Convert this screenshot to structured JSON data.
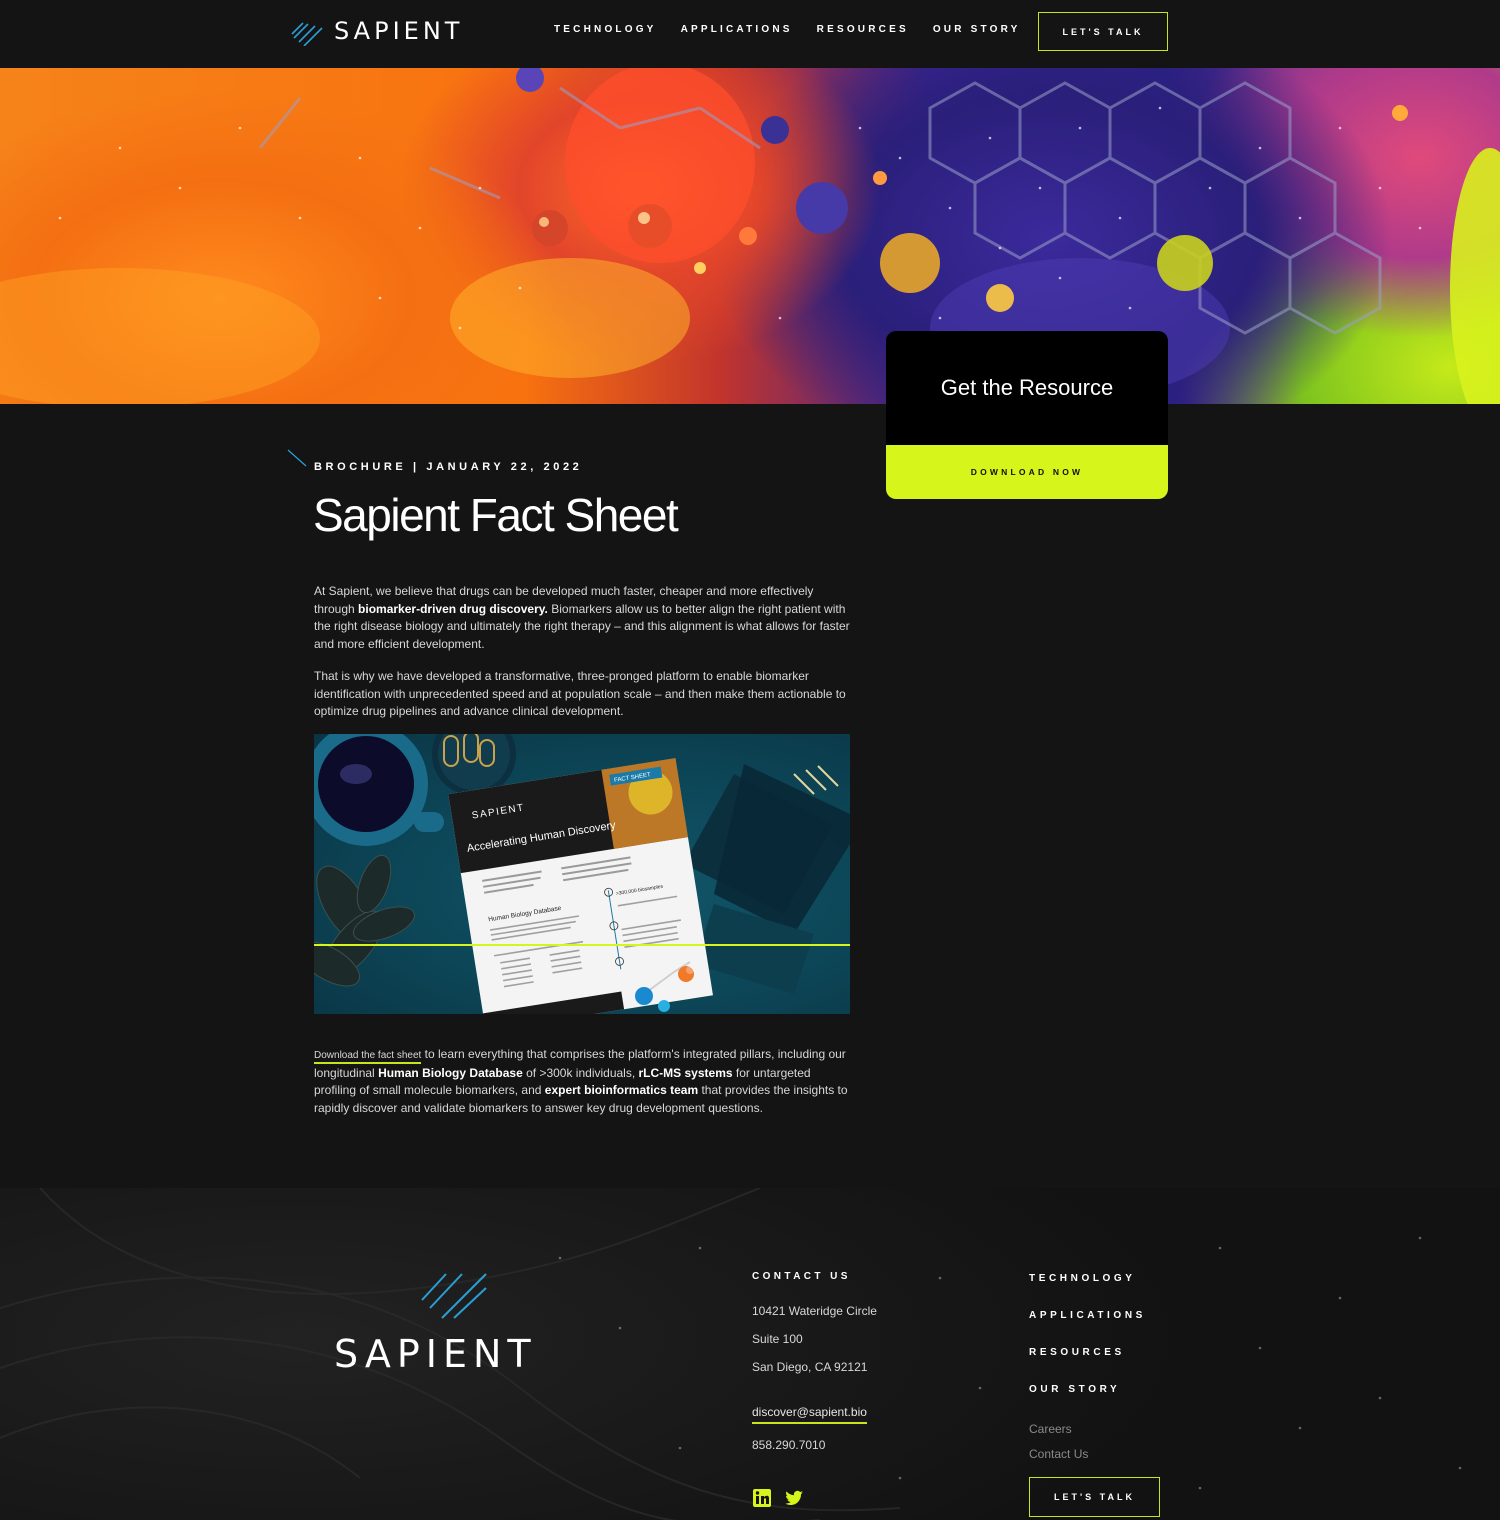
{
  "header": {
    "logo_text": "SAPIENT",
    "nav": [
      "TECHNOLOGY",
      "APPLICATIONS",
      "RESOURCES",
      "OUR STORY"
    ],
    "cta": "LET'S TALK"
  },
  "resource_card": {
    "title": "Get the Resource",
    "button": "DOWNLOAD NOW"
  },
  "article": {
    "meta": "BROCHURE | JANUARY 22, 2022",
    "title": "Sapient Fact Sheet",
    "p1_a": "At Sapient, we believe that drugs can be developed much faster, cheaper and more effectively through ",
    "p1_b": "biomarker-driven drug discovery.",
    "p1_c": " Biomarkers allow us to better align the right patient with the right disease biology and ultimately the right therapy – and this alignment is what allows for faster and more efficient development.",
    "p2": "That is why we have developed a transformative, three-pronged platform to enable biomarker identification with unprecedented speed and at population scale – and then make them actionable to optimize drug pipelines and advance clinical development.",
    "p3_link": "Download the fact sheet",
    "p3_a": " to learn everything that comprises the platform's integrated pillars, including our longitudinal ",
    "p3_b": "Human Biology Database",
    "p3_c": " of >300k individuals, ",
    "p3_d": "rLC-MS systems",
    "p3_e": " for untargeted profiling of small molecule biomarkers, and ",
    "p3_f": "expert bioinformatics team",
    "p3_g": " that provides the insights to rapidly discover and validate biomarkers to answer key drug development questions."
  },
  "product_image": {
    "sheet_brand": "SAPIENT",
    "sheet_tag": "FACT SHEET",
    "sheet_heading": "Accelerating Human Discovery",
    "sheet_section": "Human Biology Database",
    "sheet_stat": ">300,000 biosamples"
  },
  "footer": {
    "logo_text": "SAPIENT",
    "contact_heading": "CONTACT US",
    "address_line1": "10421 Wateridge Circle",
    "address_line2": "Suite 100",
    "address_line3": "San Diego, CA 92121",
    "email": "discover@sapient.bio",
    "phone": "858.290.7010",
    "nav": [
      "TECHNOLOGY",
      "APPLICATIONS",
      "RESOURCES",
      "OUR STORY"
    ],
    "links": [
      "Careers",
      "Contact Us"
    ],
    "cta": "LET'S TALK",
    "social_icons": [
      "linkedin-icon",
      "twitter-icon"
    ]
  },
  "colors": {
    "accent": "#d6f51a",
    "brand_blue": "#2a9fd6",
    "background": "#141414"
  }
}
